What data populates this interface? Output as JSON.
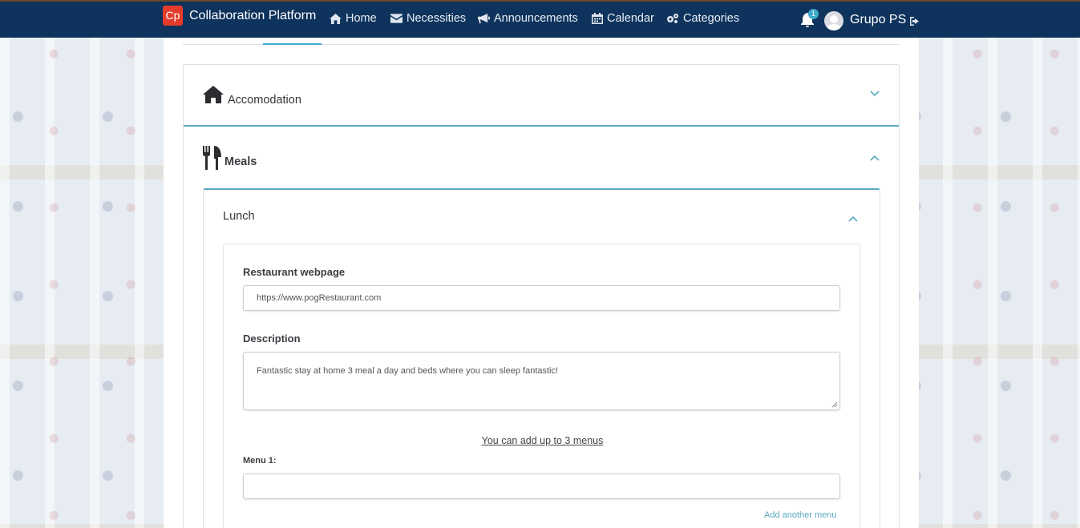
{
  "app": {
    "logo_text": "Cp",
    "title": "Collaboration Platform"
  },
  "nav": {
    "home": "Home",
    "necessities": "Necessities",
    "announcements": "Announcements",
    "calendar": "Calendar",
    "categories": "Categories",
    "notifications_count": "1",
    "user_name": "Grupo PS"
  },
  "accordion": {
    "accommodation_title": "Accomodation",
    "meals_title": "Meals"
  },
  "lunch": {
    "title": "Lunch",
    "restaurant_label": "Restaurant webpage",
    "restaurant_value": "https://www.pogRestaurant.com",
    "description_label": "Description",
    "description_value": "Fantastic stay at home 3 meal a day and beds where you can sleep fantastic!",
    "menus_note": "You can add up to 3 menus",
    "menu1_label": "Menu 1:",
    "menu1_value": "",
    "add_menu_link": "Add another menu"
  },
  "colors": {
    "navbar": "#0e335c",
    "accent": "#5aa9c1",
    "logo": "#e53b2c"
  }
}
